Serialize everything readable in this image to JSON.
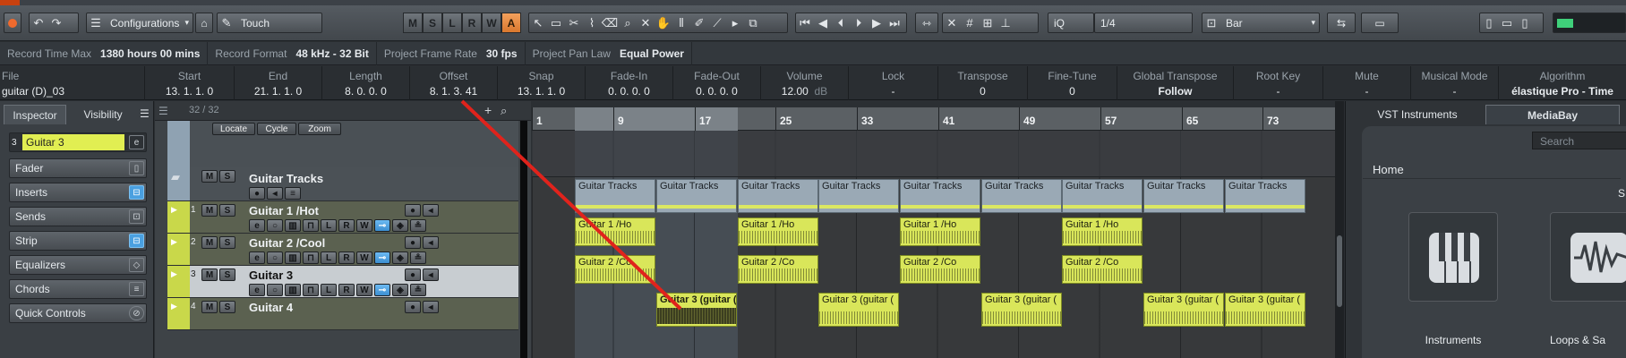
{
  "toolbar": {
    "configurations_label": "Configurations",
    "touch_label": "Touch",
    "mode_buttons": [
      "M",
      "S",
      "L",
      "R",
      "W",
      "A"
    ],
    "snap_value": "1/4",
    "snap_type": "Bar",
    "quantize_label": "iQ"
  },
  "status_bar": [
    {
      "label": "Record Time Max",
      "value": "1380 hours 00 mins"
    },
    {
      "label": "Record Format",
      "value": "48 kHz - 32 Bit"
    },
    {
      "label": "Project Frame Rate",
      "value": "30 fps"
    },
    {
      "label": "Project Pan Law",
      "value": "Equal Power"
    }
  ],
  "info_line": {
    "file": {
      "label": "File",
      "value": "guitar (D)_03"
    },
    "start": {
      "label": "Start",
      "value": "13. 1. 1. 0"
    },
    "end": {
      "label": "End",
      "value": "21. 1. 1. 0"
    },
    "length": {
      "label": "Length",
      "value": "8. 0. 0. 0"
    },
    "offset": {
      "label": "Offset",
      "value": "8. 1. 3. 41"
    },
    "snap": {
      "label": "Snap",
      "value": "13. 1. 1. 0"
    },
    "fade_in": {
      "label": "Fade-In",
      "value": "0. 0. 0. 0"
    },
    "fade_out": {
      "label": "Fade-Out",
      "value": "0. 0. 0. 0"
    },
    "volume": {
      "label": "Volume",
      "value": "12.00",
      "unit": "dB"
    },
    "lock": {
      "label": "Lock",
      "value": "-"
    },
    "transpose": {
      "label": "Transpose",
      "value": "0"
    },
    "fine_tune": {
      "label": "Fine-Tune",
      "value": "0"
    },
    "global_transpose": {
      "label": "Global Transpose",
      "value": "Follow"
    },
    "root_key": {
      "label": "Root Key",
      "value": "-"
    },
    "mute": {
      "label": "Mute",
      "value": "-"
    },
    "musical_mode": {
      "label": "Musical Mode",
      "value": "-"
    },
    "algorithm": {
      "label": "Algorithm",
      "value": "élastique Pro - Time"
    }
  },
  "inspector": {
    "tabs": [
      "Inspector",
      "Visibility"
    ],
    "track_name": "Guitar 3",
    "track_num": "3",
    "sections": [
      "Fader",
      "Inserts",
      "Sends",
      "Strip",
      "Equalizers",
      "Chords",
      "Quick Controls"
    ]
  },
  "tracklist": {
    "counter": "32 / 32",
    "transport_buttons": [
      "Locate",
      "Cycle",
      "Zoom"
    ],
    "tracks": [
      {
        "name": "Guitar Tracks",
        "num": ""
      },
      {
        "name": "Guitar 1 /Hot",
        "num": "1"
      },
      {
        "name": "Guitar 2 /Cool",
        "num": "2"
      },
      {
        "name": "Guitar 3",
        "num": "3"
      },
      {
        "name": "Guitar 4",
        "num": "4"
      }
    ]
  },
  "ruler": {
    "bars": [
      "1",
      "9",
      "17",
      "25",
      "33",
      "41",
      "49",
      "57",
      "65",
      "73"
    ]
  },
  "events": {
    "folder": [
      "Guitar Tracks",
      "Guitar Tracks",
      "Guitar Tracks",
      "Guitar Tracks",
      "Guitar Tracks",
      "Guitar Tracks",
      "Guitar Tracks",
      "Guitar Tracks",
      "Guitar Tracks"
    ],
    "guitar1": [
      "Guitar 1 /Ho",
      "Guitar 1 /Ho",
      "Guitar 1 /Ho",
      "Guitar 1 /Ho"
    ],
    "guitar2": [
      "Guitar 2 /Co",
      "Guitar 2 /Co",
      "Guitar 2 /Co",
      "Guitar 2 /Co"
    ],
    "guitar3": [
      "Guitar 3 (guitar (",
      "Guitar 3 (guitar (",
      "Guitar 3 (guitar (",
      "Guitar 3 (guitar (",
      "Guitar 3 (guitar ("
    ]
  },
  "right_zone": {
    "tabs": [
      "VST Instruments",
      "MediaBay"
    ],
    "search_placeholder": "Search",
    "home_label": "Home",
    "tiles": [
      "Instruments",
      "Loops & Sa"
    ],
    "partial_letter": "S"
  },
  "colors": {
    "event": "#d9e65a",
    "track_strip": "#c9d84a",
    "selected_track": "#c8cdd1",
    "accent_orange": "#e8893a",
    "highlight_blue": "#4aa0e0"
  }
}
